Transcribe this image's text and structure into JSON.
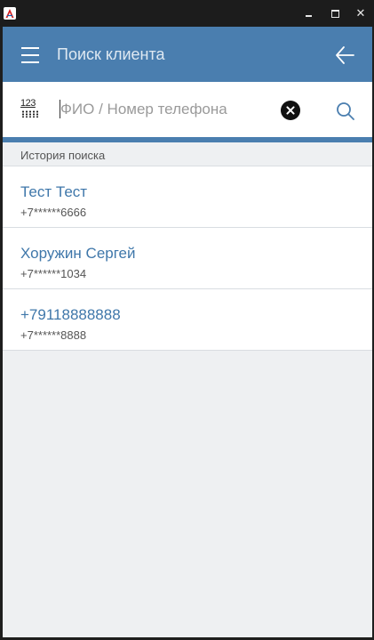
{
  "window": {
    "app_icon": "app-logo-icon",
    "buttons": {
      "minimize": "minimize-icon",
      "maximize": "maximize-icon",
      "close_glyph": "✕"
    }
  },
  "appbar": {
    "title": "Поиск клиента",
    "background": "#4a7eaf",
    "menu_icon": "hamburger-menu-icon",
    "back_icon": "back-arrow-icon"
  },
  "search": {
    "keyboard_toggle_label": "123",
    "keyboard_icon": "numeric-keyboard-icon",
    "value": "",
    "placeholder": "ФИО / Номер телефона",
    "clear_icon": "clear-circle-icon",
    "search_icon": "search-icon"
  },
  "history": {
    "header": "История поиска",
    "items": [
      {
        "name": "Тест Тест",
        "phone": "+7******6666"
      },
      {
        "name": "Хоружин Сергей",
        "phone": "+7******1034"
      },
      {
        "name": "+79118888888",
        "phone": "+7******8888"
      }
    ]
  },
  "colors": {
    "accent": "#4a7eaf",
    "link_text": "#3f77aa",
    "background": "#eef0f2",
    "titlebar": "#1c1c1c"
  }
}
